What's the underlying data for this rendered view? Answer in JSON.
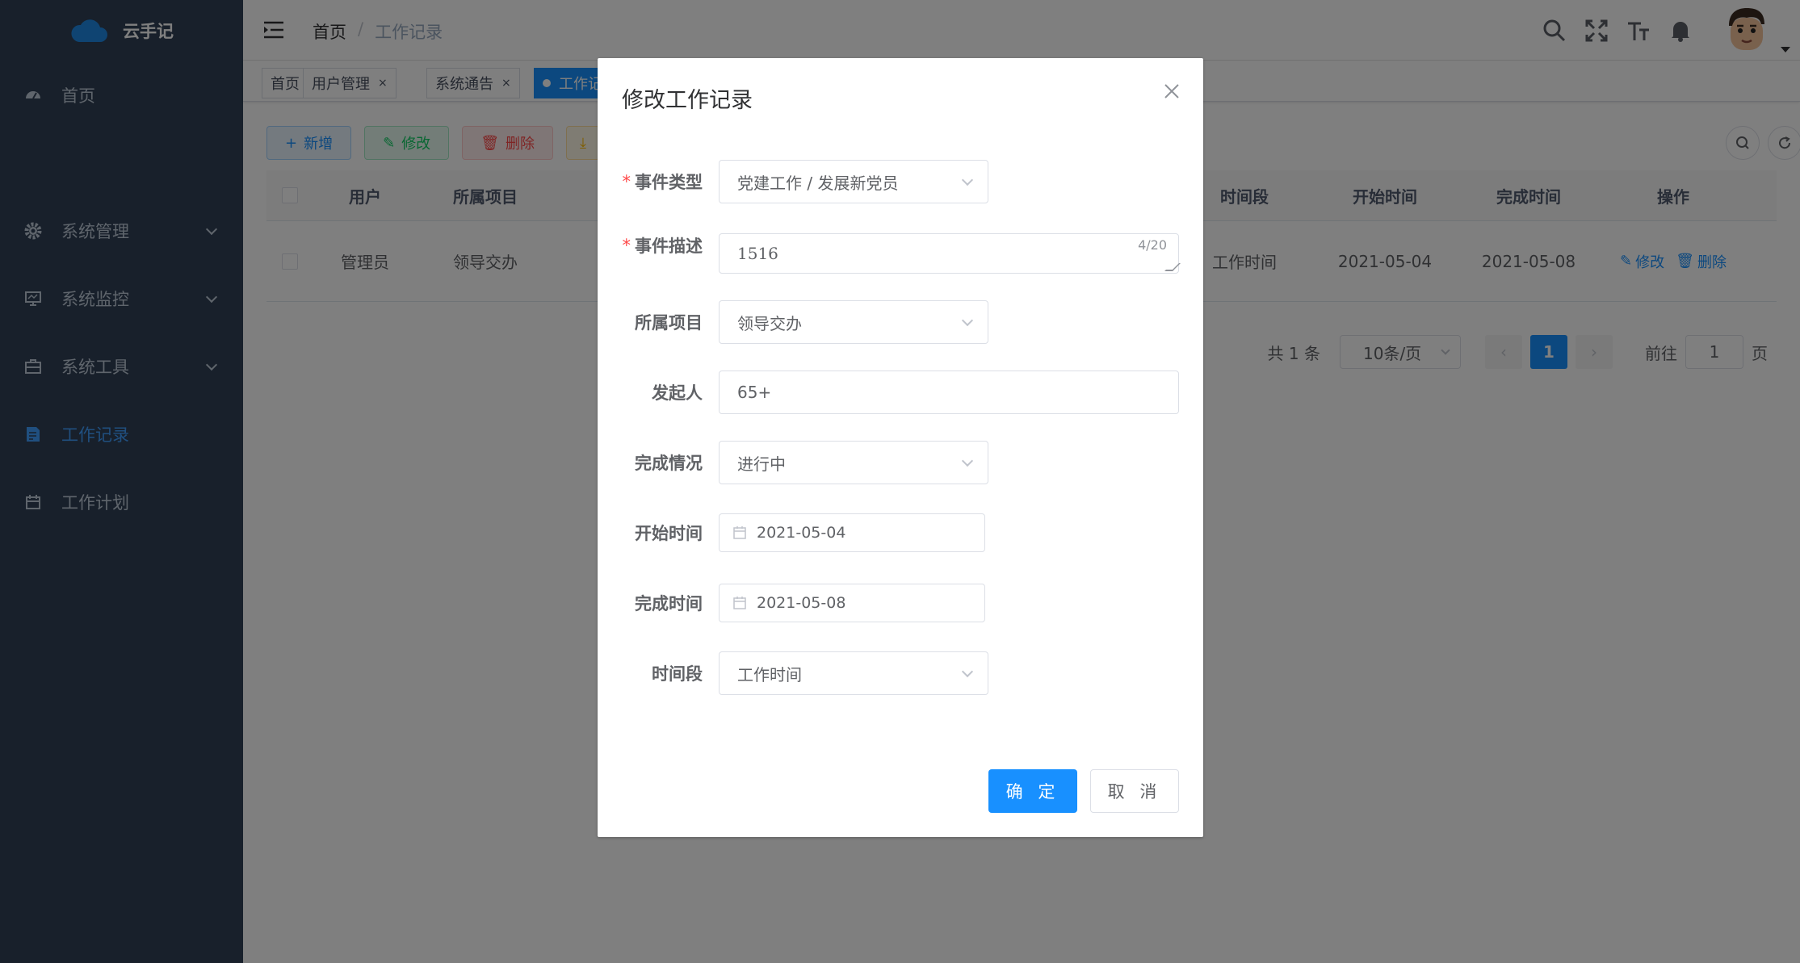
{
  "app": {
    "name": "云手记"
  },
  "sidebar": {
    "items": [
      {
        "label": "首页",
        "icon": "dashboard-icon",
        "active": false,
        "has_arrow": false
      },
      {
        "label": "系统管理",
        "icon": "gear-icon",
        "active": false,
        "has_arrow": true
      },
      {
        "label": "系统监控",
        "icon": "monitor-icon",
        "active": false,
        "has_arrow": true
      },
      {
        "label": "系统工具",
        "icon": "toolbox-icon",
        "active": false,
        "has_arrow": true
      },
      {
        "label": "工作记录",
        "icon": "document-icon",
        "active": true,
        "has_arrow": false
      },
      {
        "label": "工作计划",
        "icon": "calendar-icon",
        "active": false,
        "has_arrow": false
      }
    ]
  },
  "header": {
    "breadcrumb": {
      "home": "首页",
      "separator": "/",
      "current": "工作记录"
    }
  },
  "tags": [
    {
      "label": "首页",
      "closable": false,
      "active": false
    },
    {
      "label": "用户管理",
      "closable": true,
      "active": false
    },
    {
      "label": "系统通告",
      "closable": true,
      "active": false
    },
    {
      "label": "工作记",
      "closable": false,
      "active": true
    }
  ],
  "toolbar": {
    "add": "新增",
    "edit": "修改",
    "delete": "删除"
  },
  "table": {
    "headers": {
      "user": "用户",
      "project": "所属项目",
      "period": "时间段",
      "start": "开始时间",
      "end": "完成时间",
      "ops": "操作"
    },
    "rows": [
      {
        "user": "管理员",
        "project": "领导交办",
        "period": "工作时间",
        "start": "2021-05-04",
        "end": "2021-05-08",
        "edit": "修改",
        "delete": "删除"
      }
    ]
  },
  "pagination": {
    "total": "共 1 条",
    "page_size": "10条/页",
    "current_page": "1",
    "goto_label": "前往",
    "goto_value": "1",
    "goto_suffix": "页"
  },
  "dialog": {
    "title": "修改工作记录",
    "fields": {
      "event_type": {
        "label": "事件类型",
        "value": "党建工作 / 发展新党员",
        "required": true
      },
      "event_desc": {
        "label": "事件描述",
        "value": "1516",
        "counter": "4/20",
        "required": true
      },
      "project": {
        "label": "所属项目",
        "value": "领导交办"
      },
      "initiator": {
        "label": "发起人",
        "value": "65+"
      },
      "status": {
        "label": "完成情况",
        "value": "进行中"
      },
      "start_time": {
        "label": "开始时间",
        "value": "2021-05-04"
      },
      "end_time": {
        "label": "完成时间",
        "value": "2021-05-08"
      },
      "period": {
        "label": "时间段",
        "value": "工作时间"
      }
    },
    "confirm": "确 定",
    "cancel": "取 消"
  },
  "colors": {
    "sidebar_bg": "#304156",
    "primary": "#1890ff",
    "danger": "#ff4949",
    "success": "#13ce66",
    "warning": "#ffba00"
  }
}
